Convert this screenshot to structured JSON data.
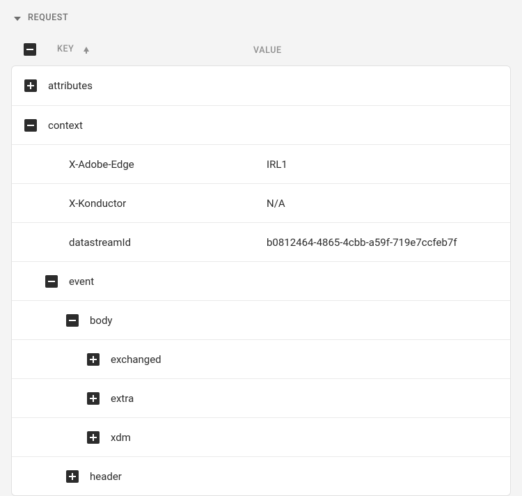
{
  "panel": {
    "title": "REQUEST"
  },
  "columns": {
    "key": "KEY",
    "value": "VALUE"
  },
  "rows": {
    "attributes": {
      "key": "attributes"
    },
    "context": {
      "key": "context"
    },
    "xAdobeEdge": {
      "key": "X-Adobe-Edge",
      "value": "IRL1"
    },
    "xKonductor": {
      "key": "X-Konductor",
      "value": "N/A"
    },
    "datastreamId": {
      "key": "datastreamId",
      "value": "b0812464-4865-4cbb-a59f-719e7ccfeb7f"
    },
    "event": {
      "key": "event"
    },
    "body": {
      "key": "body"
    },
    "exchanged": {
      "key": "exchanged"
    },
    "extra": {
      "key": "extra"
    },
    "xdm": {
      "key": "xdm"
    },
    "header": {
      "key": "header"
    }
  }
}
